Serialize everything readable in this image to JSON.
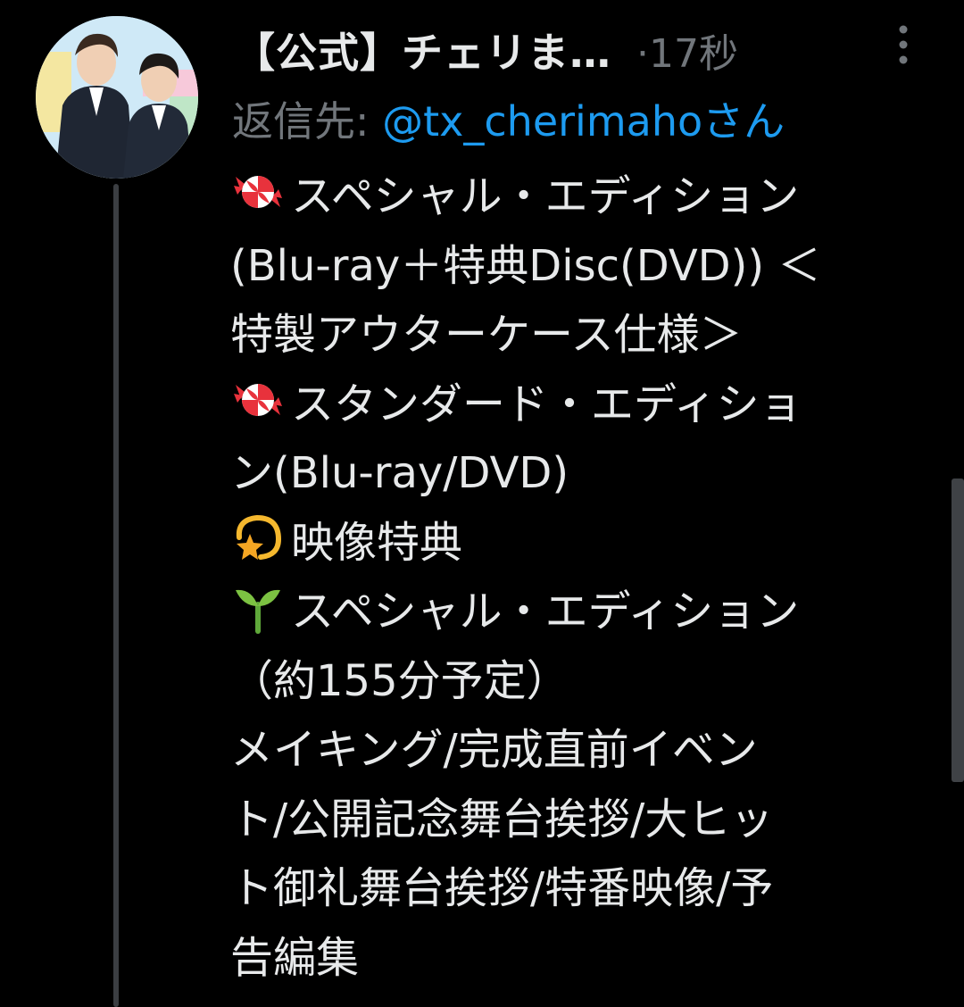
{
  "tweet": {
    "author_name": "【公式】チェリま…",
    "separator": "·",
    "time": "17秒",
    "reply_prefix": "返信先: ",
    "reply_handle": "@tx_cherimaho",
    "reply_suffix": "さん",
    "lines": [
      "スペシャル・エディション",
      "(Blu-ray＋特典Disc(DVD)) ＜",
      "特製アウターケース仕様＞",
      "スタンダード・エディショ",
      "ン(Blu-ray/DVD)",
      "映像特典",
      "スペシャル・エディション",
      "（約155分予定）",
      "メイキング/完成直前イベン",
      "ト/公開記念舞台挨拶/大ヒッ",
      "ト御礼舞台挨拶/特番映像/予",
      "告編集"
    ]
  },
  "icons": {
    "avatar": "avatar-image",
    "more": "more-vertical-icon",
    "candy": "candy-icon",
    "dizzy": "dizzy-star-icon",
    "seedling": "seedling-icon"
  },
  "colors": {
    "background": "#000000",
    "text": "#e7e9ea",
    "muted": "#71767b",
    "link": "#1d9bf0",
    "thread_line": "#3b3e42"
  }
}
